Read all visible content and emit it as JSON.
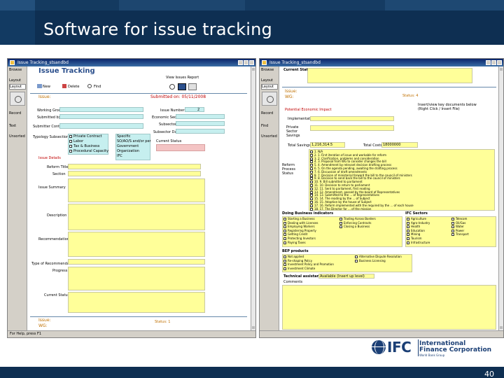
{
  "slide": {
    "title": "Software for issue tracking",
    "page_number": "40"
  },
  "left_window": {
    "window_title": "Issue Tracking_stsandbd",
    "form_title": "Issue Tracking",
    "rail": [
      "Browse",
      "Layout",
      "Layout",
      "Record",
      "Text",
      "Unsorted"
    ],
    "toolbar": [
      "New",
      "Delete",
      "Find"
    ],
    "search_hint": "View Issues Report",
    "issue_label": "Issue:",
    "submitted_on": "Submitted on: 05/11/2008",
    "labels": {
      "working_group": "Working Group:",
      "submitted_by": "Submitted by:",
      "issue_number": "Issue Number",
      "issue_number_value": "2",
      "economic_sector": "Economic Sector",
      "subsector": "Subsector",
      "submitter_contacts": "Submitter Contacts",
      "typology_subsection": "Typology Subsection",
      "subsector_data": "Subsector Data",
      "current_status": "Current Status",
      "issue_details": "Issue Details",
      "reform_title": "Reform Title",
      "section": "Section",
      "issue_summary": "Issue Summary",
      "description": "Description",
      "recommendation": "Recommendation",
      "type_of_recommendation": "Type of Recommendation",
      "progress": "Progress",
      "current_status2": "Current Status"
    },
    "typology_options": [
      "Private Contract",
      "Labor",
      "Tax & Business",
      "Procedural Capacity"
    ],
    "subsector_options": [
      "Specific",
      "SO/AO/S and/or per",
      "Government",
      "Organization",
      "IFC"
    ],
    "footer_issue": "Issue:",
    "footer_wg": "WG:",
    "footer_status": "Status: 1",
    "status_bar": "For Help, press F1"
  },
  "right_window": {
    "window_title": "Issue Tracking_stsandbd",
    "rail": [
      "Browse",
      "Layout",
      "Layout",
      "Record",
      "Find",
      "Unsorted"
    ],
    "current_status": "Current Status",
    "issue_label": "Issue:",
    "wg_label": "WG:",
    "status_label": "Status: 4",
    "insert_hint": "Insert/view key documents below (Right Click / Insert File)",
    "potential_impact": "Potential Economic Impact",
    "implementation": "Implementation",
    "private_sector_savings": "Private Sector Savings",
    "total_savings": "Total Savings",
    "total_savings_value": "1,216,314.5",
    "total_costs": "Total Costs",
    "total_costs_value": "18000000",
    "process_status_label": "Reform Process Status",
    "process_steps": [
      "1. N/A",
      "2. 1. First iteration of issue and workable for reform",
      "3. 2. Clarification, problems and consideration",
      "4. 3. Proposal from WG to consider changes the bill",
      "5. 4. Amendment by relevant decision drafting process",
      "6. 5. On the agenda pending, awaiting the drafting process",
      "7. 6. Discussion of draft amendments",
      "8. 7. Decision of ministerial forward the bill to the council of ministers",
      "9. 8. Decision to send back the bill to the council of ministers",
      "10. 9. Bill submitted to parliament",
      "11. 10. Decision to return to parliament",
      "12. 11. Sent to parliament, first reading",
      "13. 12. Amendment, passed by the board of Representatives",
      "14. 13. Submitted to the ... of Representatives",
      "15. 14. The reading by the ... of Subject",
      "16. 15. Adoption by the house of Subject",
      "17. 16. Reform implemented with the required by the ... of each house",
      "18. 17. The Director for ... of the mission"
    ],
    "business_indicators_label": "Doing Business indicators",
    "business_indicators": [
      "Starting a Business",
      "Dealing with Licenses",
      "Employing Workers",
      "Registering Property",
      "Getting Credit",
      "Protecting Investors",
      "Paying Taxes",
      "Trading Across Borders",
      "Enforcing Contracts",
      "Closing a Business"
    ],
    "ifc_subsector_label": "IFC Sectors",
    "ifc_subsectors": [
      "Agriculture",
      "Agro-Industry",
      "Health",
      "Education",
      "Mining",
      "Tourism",
      "Infrastructure",
      "Telecom",
      "Oil/Gas",
      "Water",
      "Power",
      "Transport"
    ],
    "bep_label": "BEP products",
    "bep_options": [
      "Not applied",
      "Re-shaping Policy",
      "Investment Policy and Promotion",
      "Investment Climate",
      "Alternative Dispute Resolution",
      "Business Licensing"
    ],
    "technical_assistance": "Technical assistance",
    "technical_value": "Available (Insert up level)",
    "comments": "Comments"
  },
  "logo": {
    "mark": "IFC",
    "line1": "International",
    "line2": "Finance Corporation",
    "tagline": "World Bank Group"
  }
}
